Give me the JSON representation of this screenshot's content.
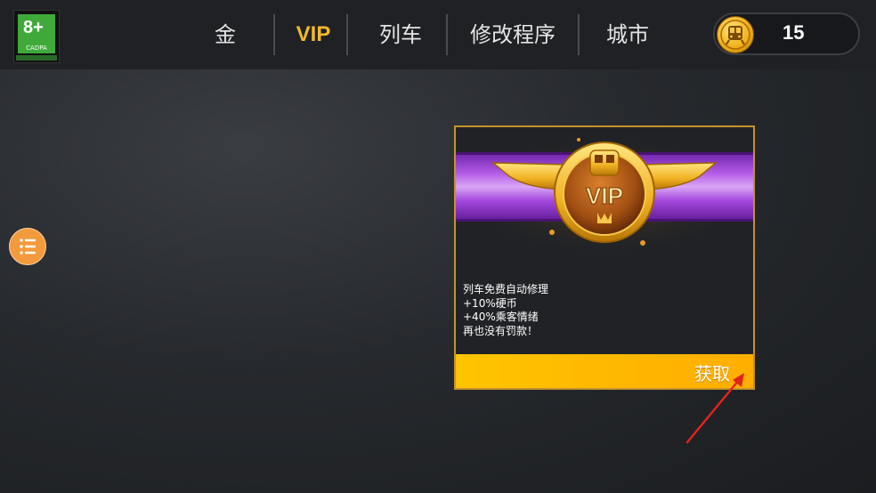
{
  "header": {
    "age_rating": {
      "number": "8+",
      "label": "CADPA"
    },
    "tabs": [
      {
        "label": "金",
        "active": false
      },
      {
        "label": "VIP",
        "active": true
      },
      {
        "label": "列车",
        "active": false
      },
      {
        "label": "修改程序",
        "active": false
      },
      {
        "label": "城市",
        "active": false
      }
    ],
    "currency": {
      "icon": "train-coin-icon",
      "amount": "15"
    }
  },
  "side_menu": {
    "icon": "list-menu-icon"
  },
  "vip_card": {
    "badge_text": "VIP",
    "benefits": [
      "列车免费自动修理",
      "+10%硬币",
      "+40%乘客情绪",
      "再也没有罚款！"
    ],
    "action_label": "获取"
  },
  "colors": {
    "accent": "#f4b82b",
    "button": "#ffba00",
    "ribbon": "#9a3fd0",
    "annotation_arrow": "#e0241b"
  }
}
